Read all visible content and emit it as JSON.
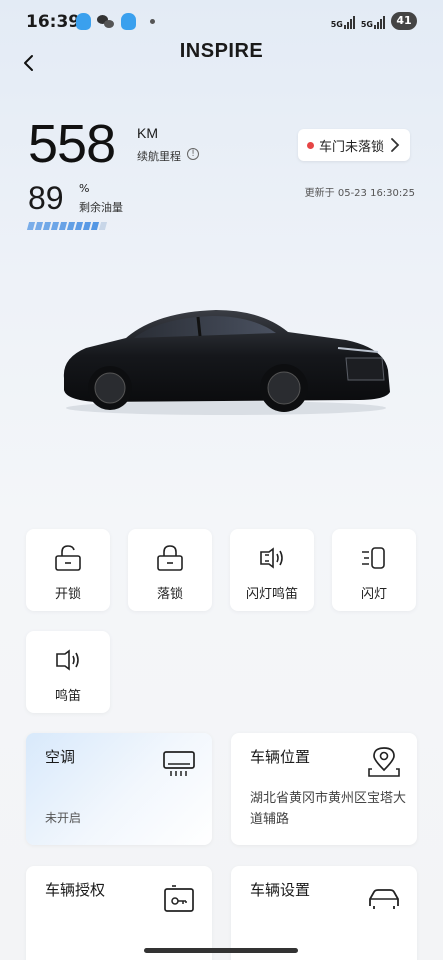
{
  "status_bar": {
    "time": "16:39",
    "network_1": "5G",
    "network_2": "5G",
    "battery": "41"
  },
  "header": {
    "title": "INSPIRE",
    "back_icon": "chevron-left-icon"
  },
  "range": {
    "value": "558",
    "unit": "KM",
    "label": "续航里程",
    "info_icon": "info-icon"
  },
  "door_status": {
    "text": "车门未落锁",
    "dot_color": "#e64545"
  },
  "fuel": {
    "value": "89",
    "unit": "%",
    "label": "剩余油量",
    "level_fraction": 0.89,
    "bar_color": "#4a90e2"
  },
  "update_time": "更新于 05-23 16:30:25",
  "quick_actions": [
    {
      "label": "开锁",
      "icon": "unlock-icon"
    },
    {
      "label": "落锁",
      "icon": "lock-icon"
    },
    {
      "label": "闪灯鸣笛",
      "icon": "flash-horn-icon"
    },
    {
      "label": "闪灯",
      "icon": "flash-lights-icon"
    },
    {
      "label": "鸣笛",
      "icon": "horn-icon"
    }
  ],
  "features": {
    "ac": {
      "title": "空调",
      "status": "未开启",
      "icon": "air-conditioner-icon"
    },
    "location": {
      "title": "车辆位置",
      "address": "湖北省黄冈市黄州区宝塔大道辅路",
      "icon": "map-pin-icon"
    },
    "authorization": {
      "title": "车辆授权",
      "icon": "key-card-icon"
    },
    "settings": {
      "title": "车辆设置",
      "icon": "car-icon"
    }
  }
}
